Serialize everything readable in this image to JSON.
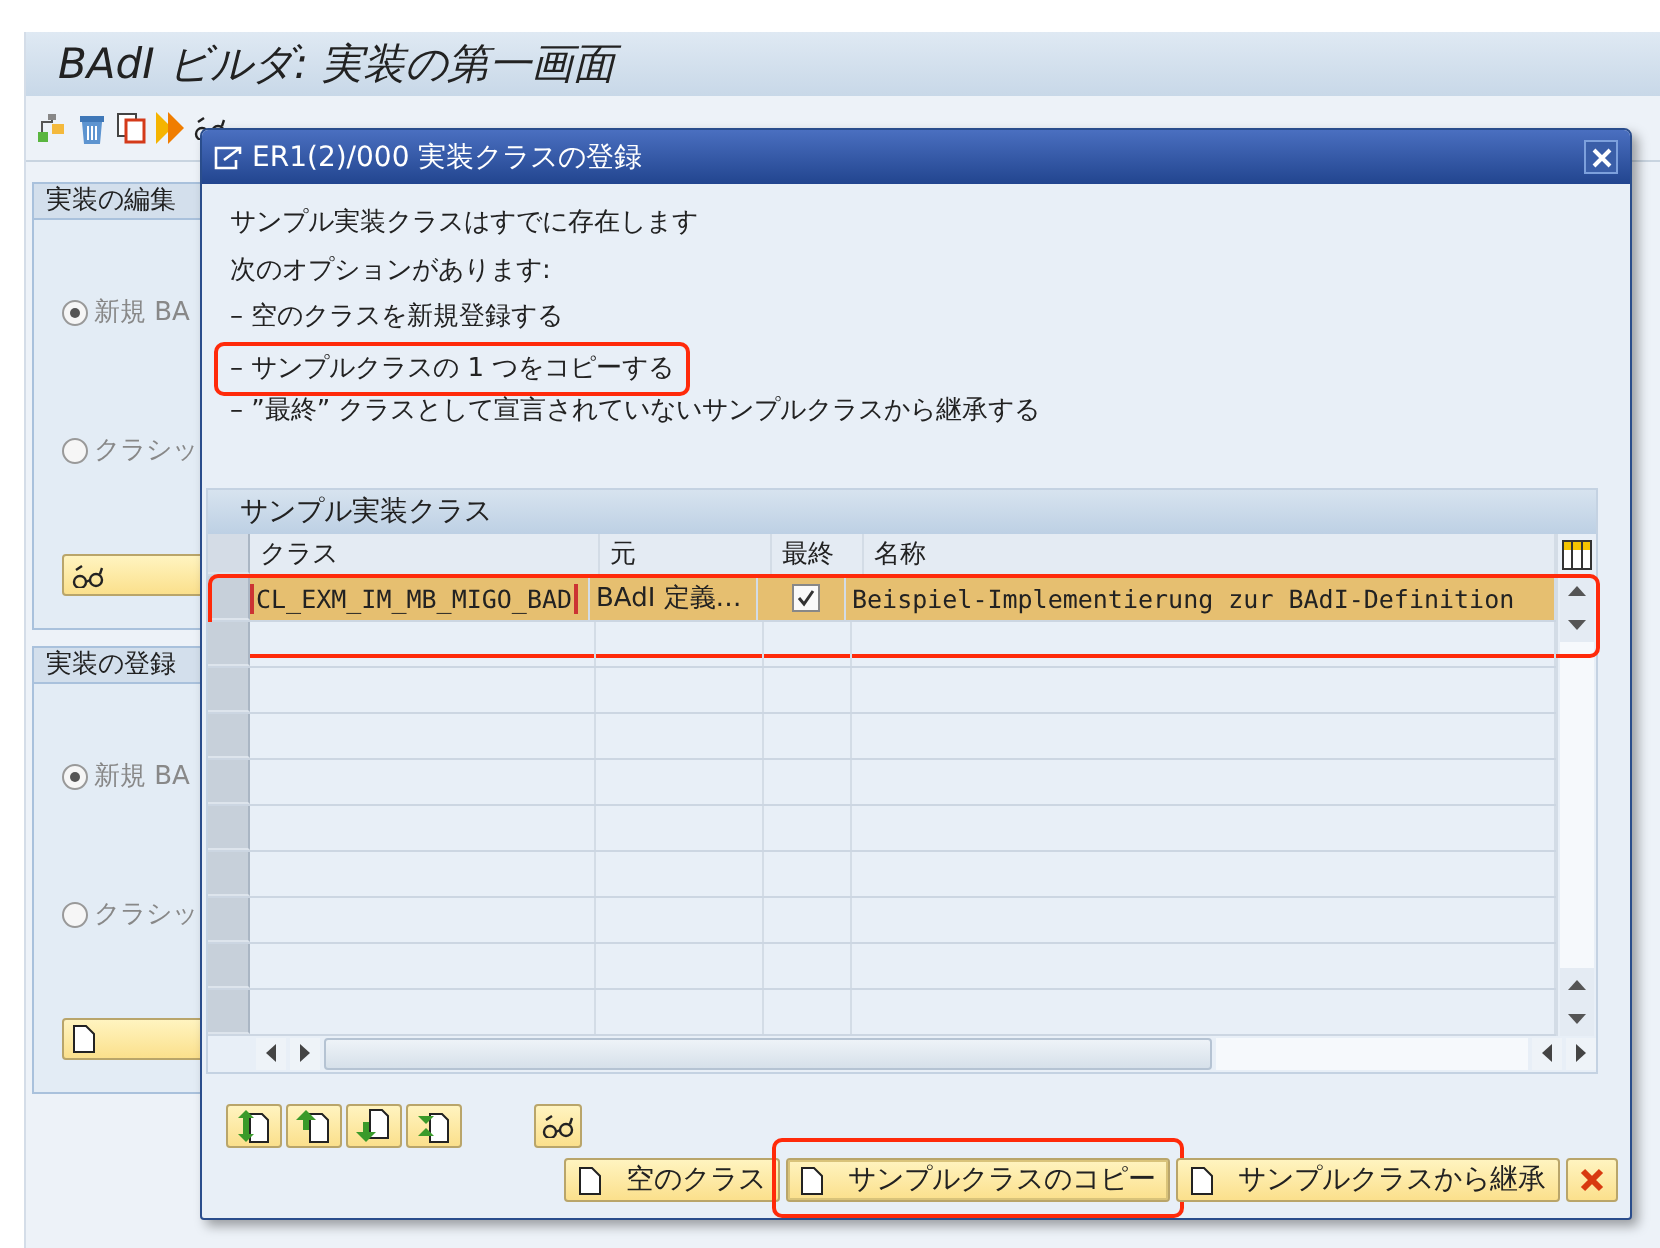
{
  "screen": {
    "title": "BAdI ビルダ: 実装の第一画面",
    "toolbar": [
      {
        "kind": "hierarchy"
      },
      {
        "kind": "delete"
      },
      {
        "kind": "copy"
      },
      {
        "kind": "transport"
      },
      {
        "kind": "display"
      }
    ],
    "panels": [
      {
        "title": "実装の編集",
        "options": [
          {
            "label": "新規 BA",
            "selected": true
          },
          {
            "label": "クラシッ",
            "selected": false
          }
        ],
        "button": {
          "kind": "display"
        }
      },
      {
        "title": "実装の登録",
        "options": [
          {
            "label": "新規 BA",
            "selected": true
          },
          {
            "label": "クラシッ",
            "selected": false
          }
        ],
        "button": {
          "kind": "create"
        }
      }
    ]
  },
  "dialog": {
    "title": "ER1(2)/000 実装クラスの登録",
    "lines": [
      {
        "text": "サンプル実装クラスはすでに存在します",
        "highlighted": false
      },
      {
        "text": "次のオプションがあります:",
        "highlighted": false
      },
      {
        "text": "– 空のクラスを新規登録する",
        "highlighted": false
      },
      {
        "text": "– サンプルクラスの 1 つをコピーする",
        "highlighted": true
      },
      {
        "text": "– ”最終” クラスとして宣言されていないサンプルクラスから継承する",
        "highlighted": false
      }
    ],
    "table": {
      "title": "サンプル実装クラス",
      "columns": [
        {
          "label": "クラス"
        },
        {
          "label": "元"
        },
        {
          "label": "最終"
        },
        {
          "label": "名称"
        }
      ],
      "rows": [
        {
          "class": "CL_EXM_IM_MB_MIGO_BAD",
          "origin": "BAdI 定義…",
          "final": true,
          "name": "Beispiel-Implementierung zur BAdI-Definition",
          "selected": true,
          "highlighted": true
        }
      ]
    },
    "nav_buttons": [
      {
        "kind": "first"
      },
      {
        "kind": "up"
      },
      {
        "kind": "down"
      },
      {
        "kind": "last"
      },
      {
        "kind": "display"
      }
    ],
    "buttons": [
      {
        "kind": "create",
        "label": "空のクラス",
        "highlighted": false
      },
      {
        "kind": "create",
        "label": "サンプルクラスのコピー",
        "highlighted": true
      },
      {
        "kind": "create",
        "label": "サンプルクラスから継承",
        "highlighted": false
      },
      {
        "kind": "cancel",
        "highlighted": false
      }
    ]
  }
}
